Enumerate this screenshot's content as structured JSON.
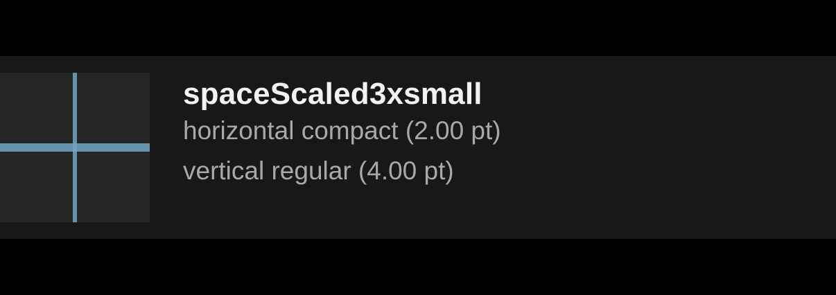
{
  "token": {
    "name": "spaceScaled3xsmall",
    "horizontal": "horizontal compact (2.00 pt)",
    "vertical": "vertical regular (4.00 pt)"
  },
  "colors": {
    "background": "#000000",
    "row_background": "#181818",
    "preview_background": "#262626",
    "guide": "#6592ad",
    "title_text": "#f2f2f2",
    "detail_text": "#a9a9a9"
  }
}
